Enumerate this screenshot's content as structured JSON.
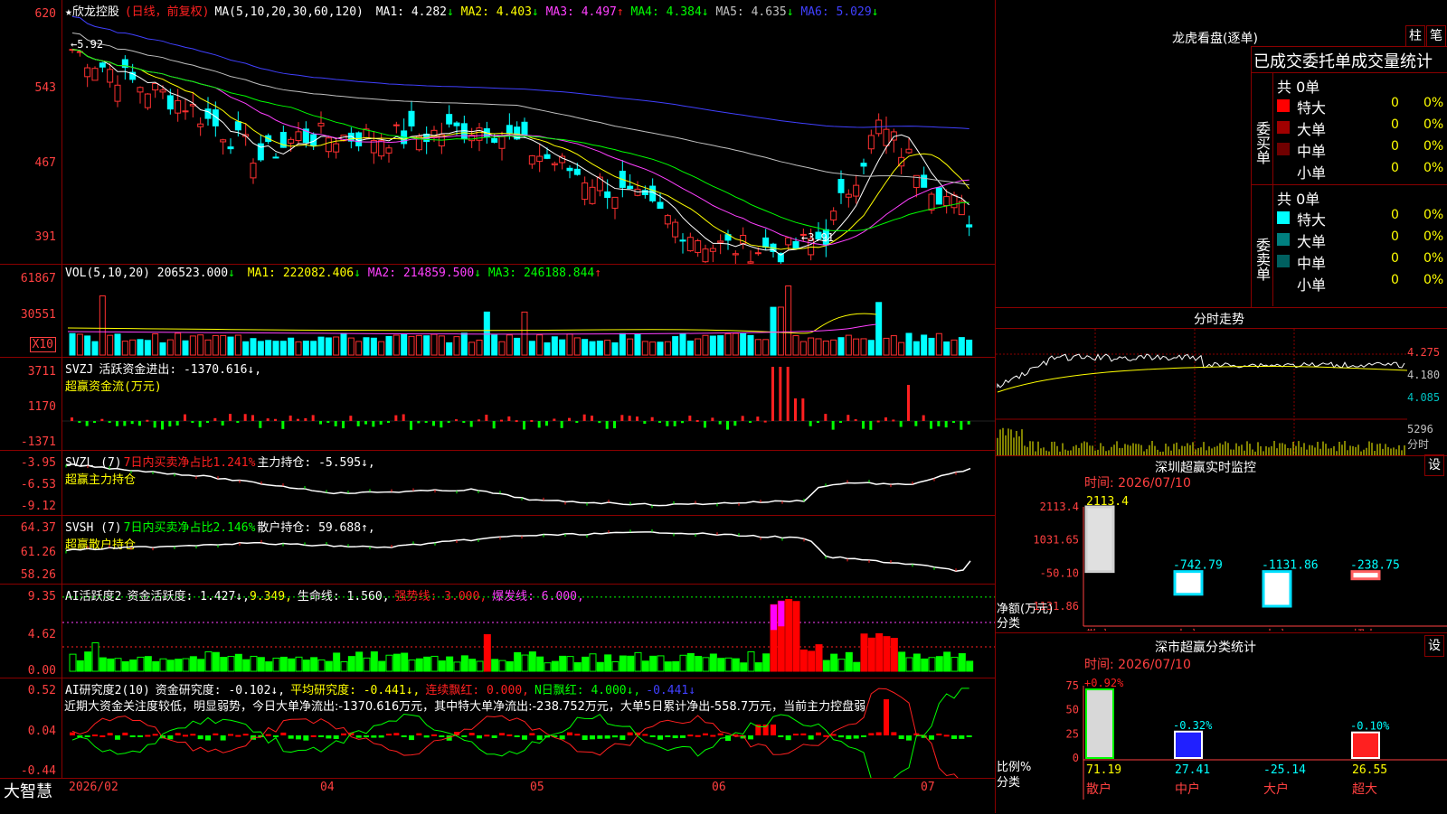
{
  "stock": {
    "star": "★",
    "name": "欣龙控股",
    "mode": "(日线，前复权)"
  },
  "main": {
    "ma_label": "MA(5,10,20,30,60,120)",
    "ma": [
      {
        "name": "MA1:",
        "value": "4.282",
        "arrow": "↓",
        "color": "#ffffff"
      },
      {
        "name": "MA2:",
        "value": "4.403",
        "arrow": "↓",
        "color": "#ffff00"
      },
      {
        "name": "MA3:",
        "value": "4.497",
        "arrow": "↑",
        "color": "#ff40ff"
      },
      {
        "name": "MA4:",
        "value": "4.384",
        "arrow": "↓",
        "color": "#00ff00"
      },
      {
        "name": "MA5:",
        "value": "4.635",
        "arrow": "↓",
        "color": "#c0c0c0"
      },
      {
        "name": "MA6:",
        "value": "5.029",
        "arrow": "↓",
        "color": "#4040ff"
      }
    ],
    "y_ticks": [
      "620",
      "543",
      "467",
      "391"
    ],
    "high_mark": "5.92",
    "low_mark": "3.91"
  },
  "vol": {
    "label": "VOL(5,10,20)",
    "value": "206523.000",
    "arrow": "↓",
    "ma": [
      {
        "name": "MA1:",
        "value": "222082.406",
        "arrow": "↓",
        "color": "#ffff00"
      },
      {
        "name": "MA2:",
        "value": "214859.500",
        "arrow": "↓",
        "color": "#ff40ff"
      },
      {
        "name": "MA3:",
        "value": "246188.844",
        "arrow": "↑",
        "color": "#00ff00"
      }
    ],
    "y_ticks": [
      "61867",
      "30551"
    ],
    "unit": "X10"
  },
  "svzj": {
    "label": "SVZJ",
    "text": "活跃资金进出: -1370.616↓,",
    "sub": "超赢资金流(万元)",
    "y_ticks": [
      "3711",
      "1170",
      "-1371"
    ]
  },
  "svzl": {
    "label": "SVZL (7)",
    "ratio": "7日内买卖净占比1.241%",
    "text": "主力持仓: -5.595↓,",
    "sub": "超赢主力持仓",
    "y_ticks": [
      "-3.95",
      "-6.53",
      "-9.12"
    ]
  },
  "svsh": {
    "label": "SVSH (7)",
    "ratio": "7日内买卖净占比2.146%",
    "text": "散户持仓: 59.688↑,",
    "sub": "超赢散户持仓",
    "y_ticks": [
      "64.37",
      "61.26",
      "58.26"
    ]
  },
  "ai1": {
    "label": "AI活跃度2",
    "t1": "资金活跃度: 1.427↓,",
    "t2": "9.349,",
    "t3": "生命线: 1.560,",
    "t4": "强势线: 3.000,",
    "t5": "爆发线: 6.000,",
    "y_ticks": [
      "9.35",
      "4.62",
      "0.00"
    ]
  },
  "ai2": {
    "label": "AI研究度2(10)",
    "t1": "资金研究度: -0.102↓,",
    "t2": "平均研究度: -0.441↓,",
    "t3": "连续飘红: 0.000,",
    "t4": "N日飘红: 4.000↓,",
    "t5": "-0.441↓",
    "note": "近期大资金关注度较低，明显弱势，今日大单净流出:-1370.616万元，其中特大单净流出:-238.752万元，大单5日累计净出-558.7万元，当前主力控盘弱",
    "y_ticks": [
      "0.52",
      "0.04",
      "-0.44"
    ]
  },
  "xaxis": {
    "brand": "大智慧",
    "labels": [
      "2026/02",
      "04",
      "05",
      "06",
      "07"
    ]
  },
  "lhb": {
    "title": "龙虎看盘(逐单)",
    "btn1": "柱",
    "btn2": "笔",
    "header": "已成交委托单成交量统计",
    "buy": {
      "label": "委买单",
      "total": "共 0单",
      "rows": [
        {
          "name": "特大",
          "v": "0",
          "p": "0%",
          "color": "#ff0000"
        },
        {
          "name": "大单",
          "v": "0",
          "p": "0%",
          "color": "#a00000"
        },
        {
          "name": "中单",
          "v": "0",
          "p": "0%",
          "color": "#700000"
        },
        {
          "name": "小单",
          "v": "0",
          "p": "0%",
          "color": ""
        }
      ]
    },
    "sell": {
      "label": "委卖单",
      "total": "共 0单",
      "rows": [
        {
          "name": "特大",
          "v": "0",
          "p": "0%",
          "color": "#00ffff"
        },
        {
          "name": "大单",
          "v": "0",
          "p": "0%",
          "color": "#008080"
        },
        {
          "name": "中单",
          "v": "0",
          "p": "0%",
          "color": "#006060"
        },
        {
          "name": "小单",
          "v": "0",
          "p": "0%",
          "color": ""
        }
      ]
    }
  },
  "fenshi": {
    "title": "分时走势",
    "y_ticks": [
      "4.275",
      "4.180",
      "4.085"
    ],
    "vol_tick": "5296",
    "vol_unit": "分时"
  },
  "monitor": {
    "title": "深圳超赢实时监控",
    "btn": "设",
    "date": "时间: 2026/07/10",
    "y_ticks": [
      "2113.4",
      "1031.65",
      "-50.10",
      "-1131.86"
    ],
    "unit": "净额(万元)",
    "cat_label": "分类",
    "chart_data": {
      "type": "bar",
      "categories": [
        "散户",
        "中户",
        "大户",
        "超大"
      ],
      "values": [
        2113.4,
        -742.79,
        -1131.86,
        -238.75
      ],
      "value_labels": [
        "2113.4",
        "-742.79",
        "-1131.86",
        "-238.75"
      ],
      "ylim": [
        -1131.86,
        2113.4
      ]
    }
  },
  "classify": {
    "title": "深市超赢分类统计",
    "btn": "设",
    "date": "时间: 2026/07/10",
    "y_ticks": [
      "75",
      "50",
      "25",
      "0"
    ],
    "unit": "比例%",
    "cat_label": "分类",
    "chart_data": {
      "type": "bar",
      "categories": [
        "散户",
        "中户",
        "大户",
        "超大"
      ],
      "values": [
        71.19,
        27.41,
        -25.14,
        26.55
      ],
      "changes": [
        "+0.92%",
        "-0.32%",
        "",
        "-0.10%"
      ],
      "ylim": [
        0,
        75
      ]
    }
  }
}
